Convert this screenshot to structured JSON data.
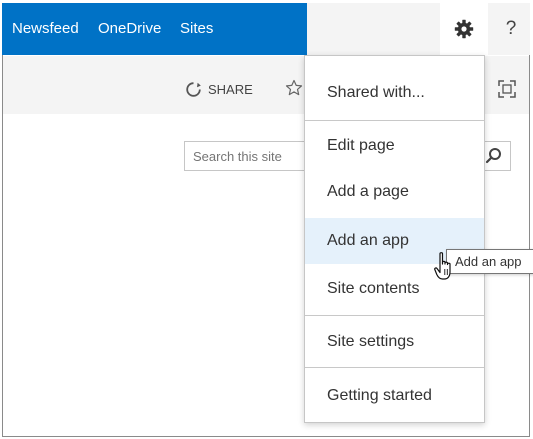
{
  "suitebar": {
    "links": [
      {
        "label": "Newsfeed"
      },
      {
        "label": "OneDrive"
      },
      {
        "label": "Sites"
      }
    ],
    "active": "Sites",
    "accent_color": "#0072c6",
    "settings_icon": "gear-icon",
    "help_label": "?"
  },
  "ribbon": {
    "share_label": "SHARE",
    "follow_icon": "star-icon",
    "focus_icon": "focus-on-content-icon"
  },
  "search": {
    "placeholder": "Search this site",
    "icon": "search-icon"
  },
  "settings_menu": {
    "items": [
      {
        "label": "Shared with..."
      },
      {
        "label": "Edit page"
      },
      {
        "label": "Add a page"
      },
      {
        "label": "Add an app"
      },
      {
        "label": "Site contents"
      },
      {
        "label": "Site settings"
      },
      {
        "label": "Getting started"
      }
    ],
    "hovered": "Add an app"
  },
  "tooltip": {
    "text": "Add an app"
  }
}
